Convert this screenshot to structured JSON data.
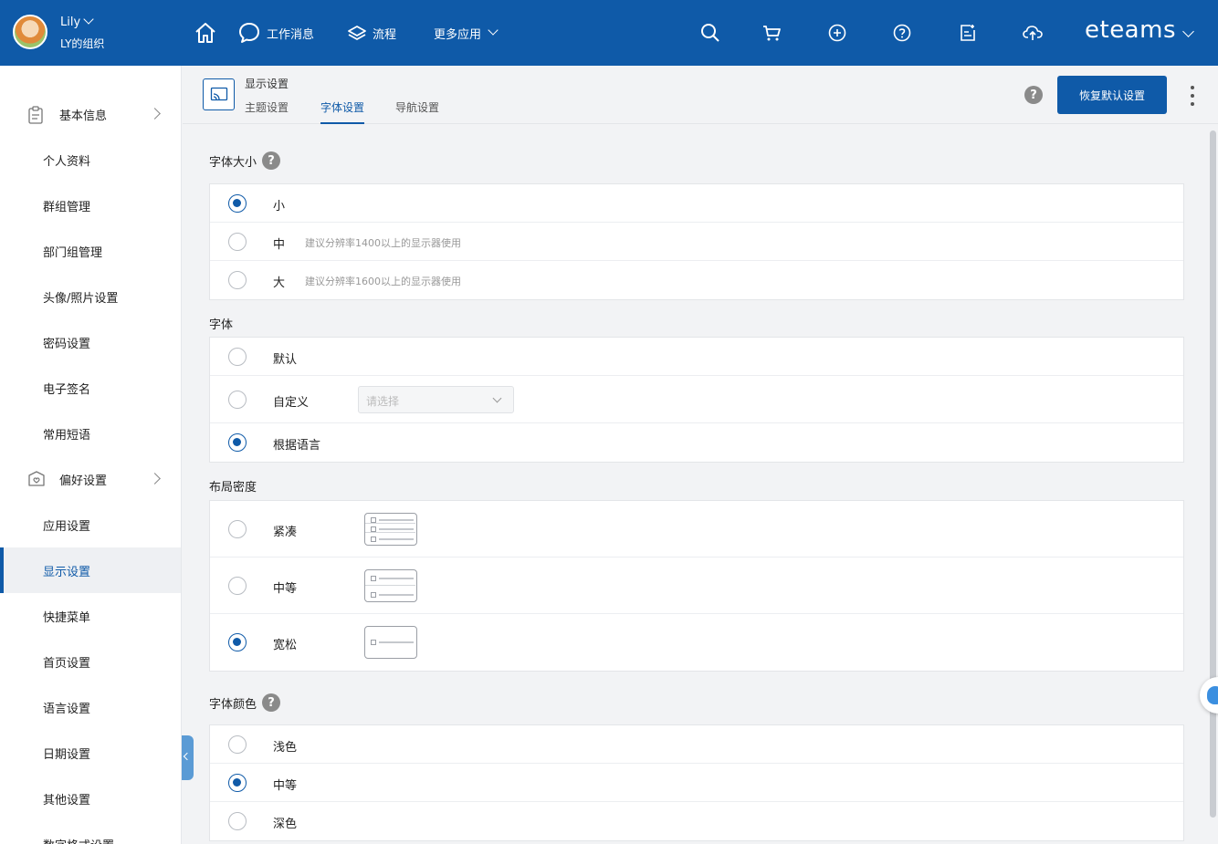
{
  "header": {
    "user_name": "Lily",
    "org_name": "LY的组织",
    "nav": {
      "messages": "工作消息",
      "flow": "流程",
      "more_apps": "更多应用"
    },
    "logo": "eteams",
    "icons": [
      "home-icon",
      "chat-icon",
      "layers-icon",
      "search-icon",
      "cart-icon",
      "plus-circle-icon",
      "help-icon",
      "report-icon",
      "cloud-upload-icon"
    ]
  },
  "sidebar": {
    "group_basic": "基本信息",
    "basic_items": [
      "个人资料",
      "群组管理",
      "部门组管理",
      "头像/照片设置",
      "密码设置",
      "电子签名",
      "常用短语"
    ],
    "group_pref": "偏好设置",
    "pref_items": [
      "应用设置",
      "显示设置",
      "快捷菜单",
      "首页设置",
      "语言设置",
      "日期设置",
      "其他设置",
      "数字格式设置"
    ],
    "active_item": "显示设置"
  },
  "page": {
    "title": "显示设置",
    "tabs": [
      "主题设置",
      "字体设置",
      "导航设置"
    ],
    "active_tab": "字体设置",
    "restore_button": "恢复默认设置"
  },
  "font_size": {
    "title": "字体大小",
    "options": [
      {
        "label": "小",
        "hint": "",
        "checked": true
      },
      {
        "label": "中",
        "hint": "建议分辨率1400以上的显示器使用",
        "checked": false
      },
      {
        "label": "大",
        "hint": "建议分辨率1600以上的显示器使用",
        "checked": false
      }
    ]
  },
  "font_family": {
    "title": "字体",
    "options": [
      {
        "label": "默认",
        "checked": false
      },
      {
        "label": "自定义",
        "checked": false
      },
      {
        "label": "根据语言",
        "checked": true
      }
    ],
    "custom_placeholder": "请选择"
  },
  "layout_density": {
    "title": "布局密度",
    "options": [
      {
        "label": "紧凑",
        "checked": false
      },
      {
        "label": "中等",
        "checked": false
      },
      {
        "label": "宽松",
        "checked": true
      }
    ]
  },
  "font_color": {
    "title": "字体颜色",
    "options": [
      {
        "label": "浅色",
        "checked": false
      },
      {
        "label": "中等",
        "checked": true
      },
      {
        "label": "深色",
        "checked": false
      }
    ]
  },
  "colors": {
    "primary": "#0f5aa8",
    "background": "#f2f3f5"
  }
}
